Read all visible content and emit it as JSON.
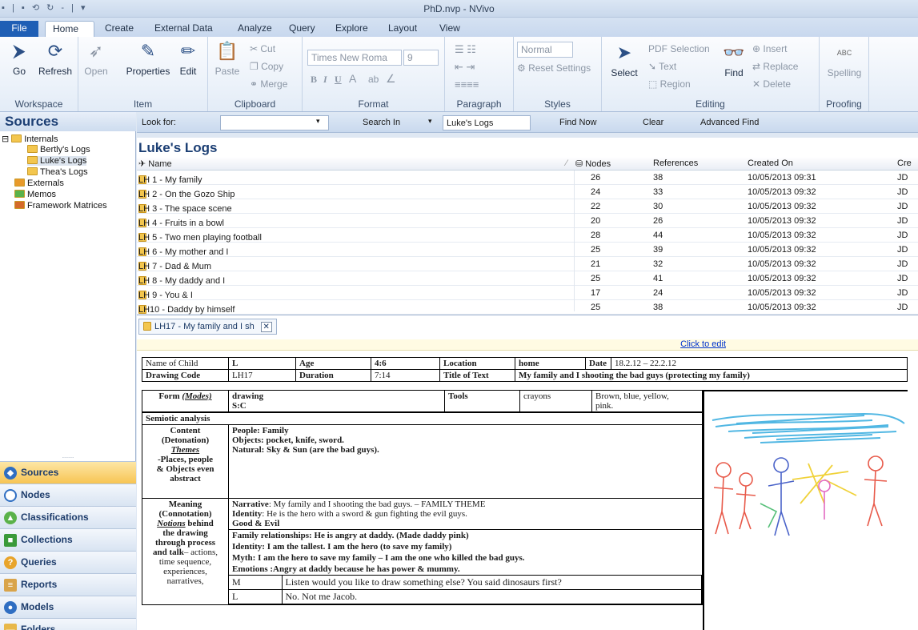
{
  "window": {
    "title": "PhD.nvp - NVivo",
    "quick_access": "▪ | ▪ ⟲ ↻ - | ▾"
  },
  "tabs": [
    "File",
    "Home",
    "Create",
    "External Data",
    "Analyze",
    "Query",
    "Explore",
    "Layout",
    "View"
  ],
  "ribbon": {
    "workspace": {
      "label": "Workspace",
      "go": "Go",
      "refresh": "Refresh"
    },
    "item": {
      "label": "Item",
      "open": "Open",
      "properties": "Properties",
      "edit": "Edit"
    },
    "clipboard": {
      "label": "Clipboard",
      "paste": "Paste",
      "cut": "Cut",
      "copy": "Copy",
      "merge": "Merge"
    },
    "format": {
      "label": "Format",
      "font": "Times New Roma",
      "size": "9",
      "bold": "B",
      "italic": "I",
      "underline": "U",
      "font_color": "A",
      "highlight": "ab",
      "clear": "∠"
    },
    "paragraph": {
      "label": "Paragraph"
    },
    "styles": {
      "label": "Styles",
      "normal": "Normal",
      "reset": "Reset Settings"
    },
    "editing": {
      "label": "Editing",
      "select": "Select",
      "pdf_selection": "PDF Selection",
      "text": "Text",
      "region": "Region",
      "find": "Find",
      "insert": "Insert",
      "replace": "Replace",
      "delete": "Delete"
    },
    "proofing": {
      "label": "Proofing",
      "spelling": "Spelling",
      "abc": "ABC"
    }
  },
  "nav": {
    "header": "Sources",
    "tree": [
      {
        "label": "Internals",
        "level": 0
      },
      {
        "label": "Bertly's Logs",
        "level": 1
      },
      {
        "label": "Luke's Logs",
        "level": 1
      },
      {
        "label": "Thea's Logs",
        "level": 1
      },
      {
        "label": "Externals",
        "level": 0
      },
      {
        "label": "Memos",
        "level": 0
      },
      {
        "label": "Framework Matrices",
        "level": 0
      }
    ],
    "buttons": [
      "Sources",
      "Nodes",
      "Classifications",
      "Collections",
      "Queries",
      "Reports",
      "Models",
      "Folders"
    ]
  },
  "findbar": {
    "look_for": "Look for:",
    "search_in": "Search In",
    "search_in_value": "Luke's Logs",
    "find_now": "Find Now",
    "clear": "Clear",
    "advanced_find": "Advanced Find"
  },
  "list": {
    "title": "Luke's Logs",
    "columns": {
      "name": "Name",
      "nodes": "Nodes",
      "references": "References",
      "created_on": "Created On",
      "created_by": "Cre"
    },
    "rows": [
      {
        "name": "LH 1 - My family",
        "nodes": "26",
        "refs": "38",
        "created": "10/05/2013 09:31",
        "by": "JD"
      },
      {
        "name": "LH 2 - On the Gozo Ship",
        "nodes": "24",
        "refs": "33",
        "created": "10/05/2013 09:32",
        "by": "JD"
      },
      {
        "name": "LH 3 - The space scene",
        "nodes": "22",
        "refs": "30",
        "created": "10/05/2013 09:32",
        "by": "JD"
      },
      {
        "name": "LH 4 - Fruits in a bowl",
        "nodes": "20",
        "refs": "26",
        "created": "10/05/2013 09:32",
        "by": "JD"
      },
      {
        "name": "LH 5 - Two men playing football",
        "nodes": "28",
        "refs": "44",
        "created": "10/05/2013 09:32",
        "by": "JD"
      },
      {
        "name": "LH 6 - My mother and I",
        "nodes": "25",
        "refs": "39",
        "created": "10/05/2013 09:32",
        "by": "JD"
      },
      {
        "name": "LH 7 - Dad & Mum",
        "nodes": "21",
        "refs": "32",
        "created": "10/05/2013 09:32",
        "by": "JD"
      },
      {
        "name": "LH 8 - My daddy and I",
        "nodes": "25",
        "refs": "41",
        "created": "10/05/2013 09:32",
        "by": "JD"
      },
      {
        "name": "LH 9 - You & I",
        "nodes": "17",
        "refs": "24",
        "created": "10/05/2013 09:32",
        "by": "JD"
      },
      {
        "name": "LH10 - Daddy by himself",
        "nodes": "25",
        "refs": "38",
        "created": "10/05/2013 09:32",
        "by": "JD"
      }
    ]
  },
  "detail": {
    "tab": "LH17 - My family and I sh",
    "click_to_edit": "Click to edit",
    "doc": {
      "name_of_child_lbl": "Name of Child",
      "name_of_child": "L",
      "age_lbl": "Age",
      "age": "4:6",
      "location_lbl": "Location",
      "location": "home",
      "date_lbl": "Date",
      "date": "18.2.12 – 22.2.12",
      "drawing_code_lbl": "Drawing Code",
      "drawing_code": "LH17",
      "duration_lbl": "Duration",
      "duration": "7:14",
      "title_lbl": "Title of Text",
      "title": "My family and I shooting the bad guys  (protecting my family)",
      "form_lbl": "Form",
      "modes": "(Modes)",
      "form_1": "drawing",
      "form_2": "S:C",
      "tools_lbl": "Tools",
      "tools": "crayons",
      "colours_1": "Brown, blue, yellow,",
      "colours_2": "pink.",
      "semiotic": "Semiotic analysis",
      "content_1": "Content",
      "content_2": "(Detonation)",
      "themes": "Themes",
      "content_3": "-Places, people",
      "content_4": "& Objects even",
      "content_5": "abstract",
      "content_text_1": "People: Family",
      "content_text_2": "Objects: pocket, knife, sword.",
      "content_text_3": "Natural: Sky & Sun (are the bad guys).",
      "meaning_1": "Meaning",
      "meaning_2": "(Connotation)",
      "notions": "Notions",
      "meaning_3": " behind",
      "meaning_4": "the drawing",
      "meaning_5": "through process",
      "meaning_6": "and talk",
      "meaning_7": "– actions,",
      "meaning_8": "time sequence,",
      "meaning_9": "experiences,",
      "meaning_10": "narratives,",
      "narrative_lbl": "Narrative",
      "narrative": ": My family and I shooting the bad guys. – FAMILY THEME",
      "identity_lbl": "Identity",
      "identity": ": He is the hero with a sword & gun fighting the evil guys.",
      "good_evil": "Good & Evil",
      "fam_1": "Family relationships: He is angry at daddy.   (Made daddy pink)",
      "fam_2": "Identity:  I am the tallest.  I am the hero (to save my family)",
      "fam_3": "Myth:  I am the hero to save my family – I am the one who killed the bad guys.",
      "fam_4": "Emotions :Angry at daddy because he has power & mummy.",
      "talk_m": "M",
      "talk_m_text": "Listen would you like to draw something else? You said dinosaurs first?",
      "talk_l": "L",
      "talk_l_text": "No. Not me Jacob."
    }
  },
  "colors": {
    "accent": "#1f5fb5",
    "header_text": "#1c3f74",
    "selected_nav": "#f7c453"
  }
}
